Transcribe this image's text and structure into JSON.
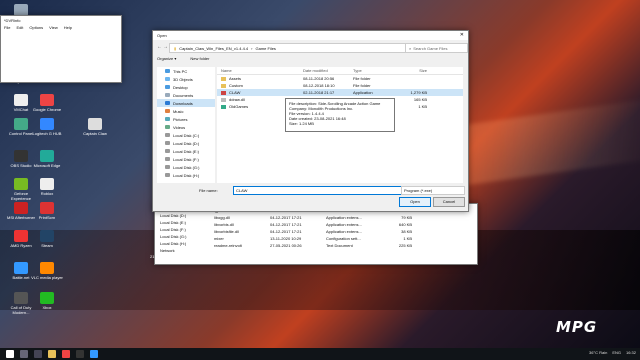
{
  "notepad": {
    "title": "​*DVRinfo",
    "menu": [
      "File",
      "Edit",
      "Options",
      "View",
      "Help"
    ]
  },
  "desktop": {
    "icons": [
      {
        "label": "This PC",
        "color": "#9ab"
      },
      {
        "label": "Network",
        "color": "#8ac"
      },
      {
        "label": "Recycle Bin",
        "color": "#ccc"
      },
      {
        "label": "VMChat",
        "color": "#eee"
      },
      {
        "label": "Google Chrome",
        "color": "#e44"
      },
      {
        "label": "Control Panel",
        "color": "#4a8"
      },
      {
        "label": "Logitech G HUB",
        "color": "#38f"
      },
      {
        "label": "Captain Claw",
        "color": "#ddd"
      },
      {
        "label": "OBS Studio",
        "color": "#333"
      },
      {
        "label": "Microsoft Edge",
        "color": "#2a9"
      },
      {
        "label": "Geforce Experience",
        "color": "#7b2"
      },
      {
        "label": "Roblox",
        "color": "#eee"
      },
      {
        "label": "MSI Afterburner",
        "color": "#c22"
      },
      {
        "label": "PrintScrn",
        "color": "#d33"
      },
      {
        "label": "AMD Ryzen",
        "color": "#e33"
      },
      {
        "label": "Steam",
        "color": "#246"
      },
      {
        "label": "Battle.net",
        "color": "#39f"
      },
      {
        "label": "VLC media player",
        "color": "#f80"
      },
      {
        "label": "Call of Duty Modern...",
        "color": "#555"
      },
      {
        "label": "Xbox",
        "color": "#2b2"
      }
    ]
  },
  "dialog": {
    "title": "Open",
    "address": [
      "Captain_Claw_Win_Files_EN_v1.4.4.4",
      "Game Files"
    ],
    "search_placeholder": "Search Game Files",
    "organize": "Organize ▾",
    "new_folder": "New folder",
    "tree": [
      {
        "label": "This PC",
        "icon": "#4a9be0"
      },
      {
        "label": "3D Objects",
        "icon": "#6cb6f0"
      },
      {
        "label": "Desktop",
        "icon": "#4a9be0"
      },
      {
        "label": "Documents",
        "icon": "#9ab"
      },
      {
        "label": "Downloads",
        "icon": "#2a7ad4"
      },
      {
        "label": "Music",
        "icon": "#e08040"
      },
      {
        "label": "Pictures",
        "icon": "#5ab"
      },
      {
        "label": "Videos",
        "icon": "#6a8"
      },
      {
        "label": "Local Disk (C:)",
        "icon": "#999"
      },
      {
        "label": "Local Disk (D:)",
        "icon": "#999"
      },
      {
        "label": "Local Disk (E:)",
        "icon": "#999"
      },
      {
        "label": "Local Disk (F:)",
        "icon": "#999"
      },
      {
        "label": "Local Disk (G:)",
        "icon": "#999"
      },
      {
        "label": "Local Disk (H:)",
        "icon": "#999"
      }
    ],
    "headers": [
      "Name",
      "Date modified",
      "Type",
      "Size"
    ],
    "files": [
      {
        "name": "Assets",
        "date": "08-11-2018 20:56",
        "type": "File folder",
        "size": "",
        "icon": "#e8c15a"
      },
      {
        "name": "Custom",
        "date": "08-12-2018 18:10",
        "type": "File folder",
        "size": "",
        "icon": "#e8c15a"
      },
      {
        "name": "CLAW",
        "date": "02-11-2018 21:17",
        "type": "Application",
        "size": "1,279 KB",
        "icon": "#c44"
      },
      {
        "name": "ddraw.dll",
        "date": "08-11-2018 20:56",
        "type": "Application",
        "size": "165 KB",
        "icon": "#bbb"
      },
      {
        "name": "OldGames",
        "date": "02-11-2018 21:17",
        "type": "Internet Shortcut",
        "size": "1 KB",
        "icon": "#3a8"
      }
    ],
    "tooltip": [
      "File description: Side-Scrolling Arcade Action Game",
      "Company: Monolith Productions Inc.",
      "File version: 1.4.4.4",
      "Date created: 23-08-2021 16:48",
      "Size: 1.24 MB"
    ],
    "filename_label": "File name:",
    "filename_value": "CLAW",
    "filetype": "Program (*.exe)",
    "open_label": "Open",
    "cancel_label": "Cancel"
  },
  "explorer_bg": {
    "left": [
      "Local Disk (C:)",
      "Local Disk (D:)",
      "Local Disk (E:)",
      "Local Disk (F:)",
      "Local Disk (G:)",
      "Local Disk (H:)",
      "Network"
    ],
    "rows": [
      {
        "name": "lgpl-3.0",
        "date": "23-02-2021 13:07",
        "type": "Text Document",
        "size": "8 KB"
      },
      {
        "name": "libogg.dll",
        "date": "04-12-2017 17:21",
        "type": "Application extens...",
        "size": "79 KB"
      },
      {
        "name": "libvorbis.dll",
        "date": "04-12-2017 17:21",
        "type": "Application extens...",
        "size": "640 KB"
      },
      {
        "name": "libvorbisfile.dll",
        "date": "04-12-2017 17:21",
        "type": "Application extens...",
        "size": "38 KB"
      },
      {
        "name": "mixer",
        "date": "13-11-2020 10:29",
        "type": "Configuration sett...",
        "size": "1 KB"
      },
      {
        "name": "readme-reinvolt",
        "date": "27-05-2021 00:26",
        "type": "Text Document",
        "size": "225 KB"
      }
    ],
    "status": "21 items     1 item selected  1.47 MB"
  },
  "watermark": "MPG",
  "taskbar": {
    "weather": "36°C  Rain",
    "lang": "ENG",
    "time": "16:32"
  }
}
